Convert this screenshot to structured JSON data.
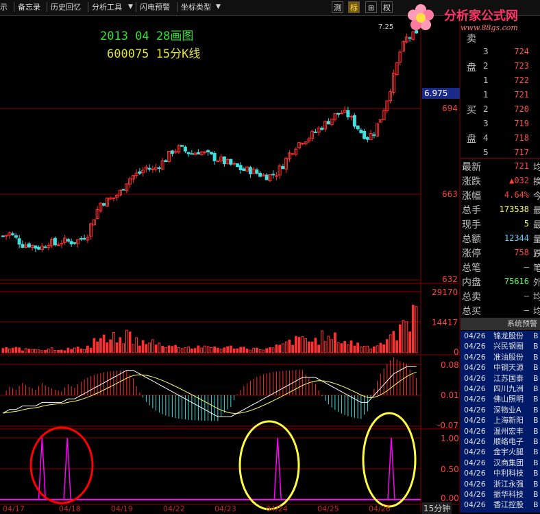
{
  "toolbar": {
    "items": [
      "示",
      "备忘录",
      "历史回忆",
      "分析工具",
      "闪电预警",
      "坐标类型"
    ],
    "right_buttons": [
      "测",
      "标",
      "⊞",
      "权"
    ],
    "active_right": 1
  },
  "watermark": {
    "title": "分析家公式网",
    "url": "www.88gs.com"
  },
  "annotation": {
    "line1": "2013 04 28画图",
    "line2": "600075 15分K线"
  },
  "price_axis": {
    "top_label": "7.25",
    "current": "6.975",
    "ticks": [
      "694",
      "663",
      "632"
    ]
  },
  "volume_axis": {
    "ticks": [
      "29170",
      "14417",
      "0"
    ]
  },
  "macd_axis": {
    "ticks": [
      "0.08",
      "0.01",
      "-0.07"
    ]
  },
  "signal_axis": {
    "ticks": [
      "1.00",
      "0.50",
      "0.00"
    ]
  },
  "x_axis": {
    "labels": [
      "04/17",
      "04/18",
      "04/19",
      "04/22",
      "04/23",
      "04/24",
      "04/25",
      "04/26"
    ]
  },
  "timeframe": "15分钟",
  "order_book": {
    "sell_label": [
      "卖",
      "盘"
    ],
    "sell": [
      {
        "n": "3",
        "price": "724"
      },
      {
        "n": "2",
        "price": "723"
      },
      {
        "n": "1",
        "price": "722"
      }
    ],
    "buy_label": [
      "买",
      "盘"
    ],
    "buy": [
      {
        "n": "1",
        "price": "721"
      },
      {
        "n": "2",
        "price": "720"
      },
      {
        "n": "3",
        "price": "719"
      },
      {
        "n": "4",
        "price": "718"
      },
      {
        "n": "5",
        "price": "717"
      }
    ]
  },
  "stats": [
    {
      "label": "最新",
      "value": "721",
      "color": "#ff4040",
      "cut": "均"
    },
    {
      "label": "涨跌",
      "value": "▲032",
      "color": "#ff4040",
      "cut": "换"
    },
    {
      "label": "涨幅",
      "value": "4.64%",
      "color": "#ff4040",
      "cut": "今"
    },
    {
      "label": "总手",
      "value": "173538",
      "color": "#ffff60",
      "cut": "最"
    },
    {
      "label": "现手",
      "value": "5",
      "color": "#ffff60",
      "cut": "最"
    },
    {
      "label": "总额",
      "value": "12344",
      "color": "#60d0ff",
      "cut": "量"
    },
    {
      "label": "涨停",
      "value": "758",
      "color": "#ff4040",
      "cut": "跌"
    },
    {
      "label": "总笔",
      "value": "–",
      "color": "#c0c0c0",
      "cut": "笔"
    },
    {
      "label": "内盘",
      "value": "75616",
      "color": "#60ff60",
      "cut": "外"
    },
    {
      "label": "总卖",
      "value": "–",
      "color": "#c0c0c0",
      "cut": "均"
    },
    {
      "label": "总买",
      "value": "–",
      "color": "#c0c0c0",
      "cut": "均"
    }
  ],
  "alerts": {
    "header": "系统预警",
    "rows": [
      {
        "date": "04/26",
        "name": "锦龙股份",
        "cut": "B"
      },
      {
        "date": "04/26",
        "name": "兴民钢圈",
        "cut": "B"
      },
      {
        "date": "04/26",
        "name": "准油股份",
        "cut": "B"
      },
      {
        "date": "04/26",
        "name": "中钢天源",
        "cut": "B"
      },
      {
        "date": "04/26",
        "name": "江苏国泰",
        "cut": "B"
      },
      {
        "date": "04/26",
        "name": "四川九洲",
        "cut": "B"
      },
      {
        "date": "04/26",
        "name": "佛山照明",
        "cut": "B"
      },
      {
        "date": "04/26",
        "name": "深物业A",
        "cut": "B"
      },
      {
        "date": "04/26",
        "name": "上海新阳",
        "cut": "B"
      },
      {
        "date": "04/26",
        "name": "温州宏丰",
        "cut": "B"
      },
      {
        "date": "04/26",
        "name": "顺络电子",
        "cut": "B"
      },
      {
        "date": "04/26",
        "name": "金宇火腿",
        "cut": "B"
      },
      {
        "date": "04/26",
        "name": "汉商集团",
        "cut": "B"
      },
      {
        "date": "04/26",
        "name": "中利科技",
        "cut": "B"
      },
      {
        "date": "04/26",
        "name": "浙江永强",
        "cut": "B"
      },
      {
        "date": "04/26",
        "name": "振华科技",
        "cut": "B"
      },
      {
        "date": "04/26",
        "name": "香江控股",
        "cut": "B"
      }
    ]
  },
  "colors": {
    "up": "#ff3030",
    "down": "#40e0e0",
    "grid": "#8b0000",
    "signal": "#ff00ff",
    "red_circle": "#ff0000",
    "yellow_circle": "#ffff40"
  },
  "chart_data": {
    "type": "candlestick",
    "price_range": [
      6.32,
      7.25
    ],
    "closes": [
      6.48,
      6.49,
      6.47,
      6.45,
      6.45,
      6.44,
      6.44,
      6.46,
      6.45,
      6.46,
      6.46,
      6.46,
      6.47,
      6.49,
      6.55,
      6.6,
      6.61,
      6.62,
      6.64,
      6.68,
      6.7,
      6.71,
      6.73,
      6.72,
      6.74,
      6.76,
      6.79,
      6.8,
      6.79,
      6.78,
      6.79,
      6.78,
      6.77,
      6.76,
      6.75,
      6.74,
      6.73,
      6.72,
      6.72,
      6.71,
      6.7,
      6.7,
      6.71,
      6.74,
      6.78,
      6.81,
      6.83,
      6.84,
      6.86,
      6.88,
      6.9,
      6.92,
      6.93,
      6.92,
      6.89,
      6.86,
      6.84,
      6.86,
      6.91,
      6.98,
      7.06,
      7.15,
      7.2,
      7.21
    ],
    "volumes_pct": [
      8,
      6,
      7,
      5,
      6,
      6,
      5,
      7,
      6,
      5,
      6,
      7,
      8,
      10,
      20,
      22,
      18,
      24,
      18,
      30,
      20,
      16,
      14,
      18,
      14,
      12,
      10,
      10,
      9,
      8,
      10,
      8,
      9,
      8,
      8,
      9,
      8,
      8,
      7,
      6,
      6,
      7,
      10,
      14,
      18,
      20,
      24,
      18,
      20,
      26,
      22,
      24,
      18,
      16,
      14,
      12,
      10,
      12,
      16,
      22,
      30,
      40,
      50,
      100
    ],
    "dif": [
      -0.05,
      -0.04,
      -0.04,
      -0.03,
      -0.03,
      -0.03,
      -0.02,
      -0.02,
      -0.02,
      -0.02,
      -0.01,
      -0.01,
      0.0,
      0.01,
      0.02,
      0.03,
      0.04,
      0.05,
      0.06,
      0.07,
      0.07,
      0.06,
      0.05,
      0.04,
      0.03,
      0.02,
      0.01,
      0.0,
      -0.01,
      -0.02,
      -0.03,
      -0.04,
      -0.05,
      -0.06,
      -0.06,
      -0.06,
      -0.05,
      -0.04,
      -0.03,
      -0.02,
      -0.01,
      0.0,
      0.01,
      0.02,
      0.03,
      0.04,
      0.05,
      0.05,
      0.05,
      0.04,
      0.03,
      0.02,
      0.01,
      0.0,
      -0.01,
      -0.02,
      -0.02,
      0.0,
      0.02,
      0.04,
      0.06,
      0.07,
      0.08,
      0.08
    ],
    "signal_peaks": [
      0.1,
      0.16,
      0.66,
      0.93
    ],
    "x_labels": [
      "04/17",
      "04/18",
      "04/19",
      "04/22",
      "04/23",
      "04/24",
      "04/25",
      "04/26"
    ]
  }
}
